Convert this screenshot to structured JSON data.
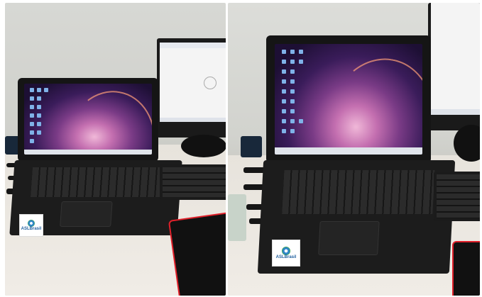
{
  "photos": [
    {
      "label": "left-photo",
      "sticker_text": "ASLBrasil"
    },
    {
      "label": "right-photo",
      "sticker_text": "ASLBrasil"
    }
  ],
  "colors": {
    "wallpaper_core": "#f0b8d8",
    "wallpaper_outer": "#1d0f34",
    "desk": "#ece8e1",
    "device_black": "#151515",
    "mousepad_red": "#e0202a"
  }
}
